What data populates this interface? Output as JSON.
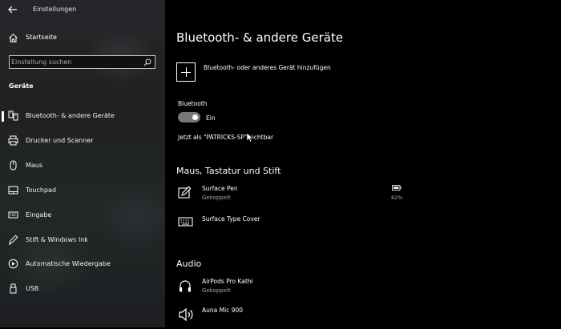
{
  "window": {
    "title": "Einstellungen"
  },
  "sidebar": {
    "home_label": "Startseite",
    "search_placeholder": "Einstellung suchen",
    "section_title": "Geräte",
    "items": [
      {
        "label": "Bluetooth- & andere Geräte",
        "icon": "bluetooth-devices-icon",
        "selected": true
      },
      {
        "label": "Drucker und Scanner",
        "icon": "printer-icon"
      },
      {
        "label": "Maus",
        "icon": "mouse-icon"
      },
      {
        "label": "Touchpad",
        "icon": "touchpad-icon"
      },
      {
        "label": "Eingabe",
        "icon": "keyboard-icon"
      },
      {
        "label": "Stift & Windows Ink",
        "icon": "pen-icon"
      },
      {
        "label": "Automatische Wiedergabe",
        "icon": "autoplay-icon"
      },
      {
        "label": "USB",
        "icon": "usb-icon"
      }
    ]
  },
  "main": {
    "title": "Bluetooth- & andere Geräte",
    "add_device_label": "Bluetooth- oder anderes Gerät hinzufügen",
    "bluetooth_label": "Bluetooth",
    "bluetooth_state": "Ein",
    "visible_as": "Jetzt als \"PATRICKS-SP\" sichtbar",
    "sections": [
      {
        "title": "Maus, Tastatur und Stift",
        "devices": [
          {
            "name": "Surface Pen",
            "status": "Gekoppelt",
            "battery": "82%",
            "icon": "pen-icon"
          },
          {
            "name": "Surface Type Cover",
            "status": "",
            "icon": "keyboard-icon"
          }
        ]
      },
      {
        "title": "Audio",
        "devices": [
          {
            "name": "AirPods Pro Kathi",
            "status": "Gekoppelt",
            "icon": "headphones-icon"
          },
          {
            "name": "Auna Mic 900",
            "status": "",
            "icon": "speaker-icon"
          }
        ]
      }
    ]
  }
}
